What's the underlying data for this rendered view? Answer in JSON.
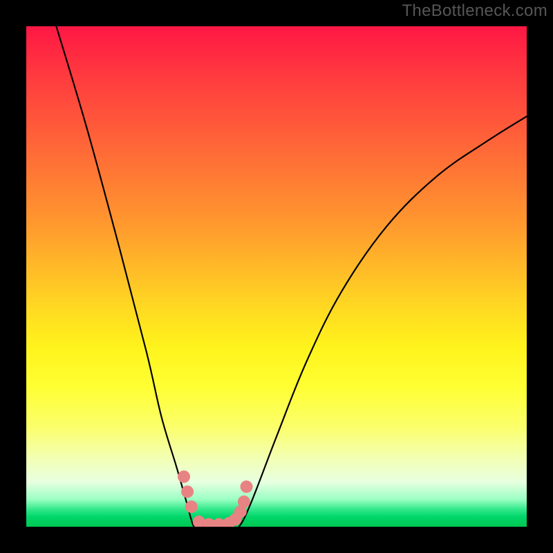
{
  "watermark": "TheBottleneck.com",
  "chart_data": {
    "type": "line",
    "title": "",
    "xlabel": "",
    "ylabel": "",
    "xlim": [
      0,
      100
    ],
    "ylim": [
      0,
      100
    ],
    "grid": false,
    "series": [
      {
        "name": "left-descent",
        "x": [
          6,
          12,
          18,
          24,
          27,
          30,
          32,
          33.5
        ],
        "y": [
          100,
          80,
          58,
          35,
          22,
          12,
          5,
          0
        ]
      },
      {
        "name": "valley-floor",
        "x": [
          33.5,
          35,
          37,
          39,
          41,
          42.5
        ],
        "y": [
          0,
          0,
          0,
          0,
          0,
          0
        ]
      },
      {
        "name": "right-ascent",
        "x": [
          42.5,
          45,
          50,
          56,
          63,
          72,
          82,
          92,
          100
        ],
        "y": [
          0,
          5,
          18,
          33,
          47,
          60,
          70,
          77,
          82
        ]
      }
    ],
    "markers": {
      "name": "highlighted-points",
      "color": "#e88383",
      "points": [
        {
          "x": 31.5,
          "y": 10
        },
        {
          "x": 32.2,
          "y": 7
        },
        {
          "x": 33.0,
          "y": 4
        },
        {
          "x": 34.5,
          "y": 1
        },
        {
          "x": 36.5,
          "y": 0.5
        },
        {
          "x": 38.5,
          "y": 0.5
        },
        {
          "x": 40.5,
          "y": 0.7
        },
        {
          "x": 41.8,
          "y": 1.5
        },
        {
          "x": 42.8,
          "y": 3
        },
        {
          "x": 43.5,
          "y": 5
        },
        {
          "x": 44.0,
          "y": 8
        }
      ]
    }
  }
}
